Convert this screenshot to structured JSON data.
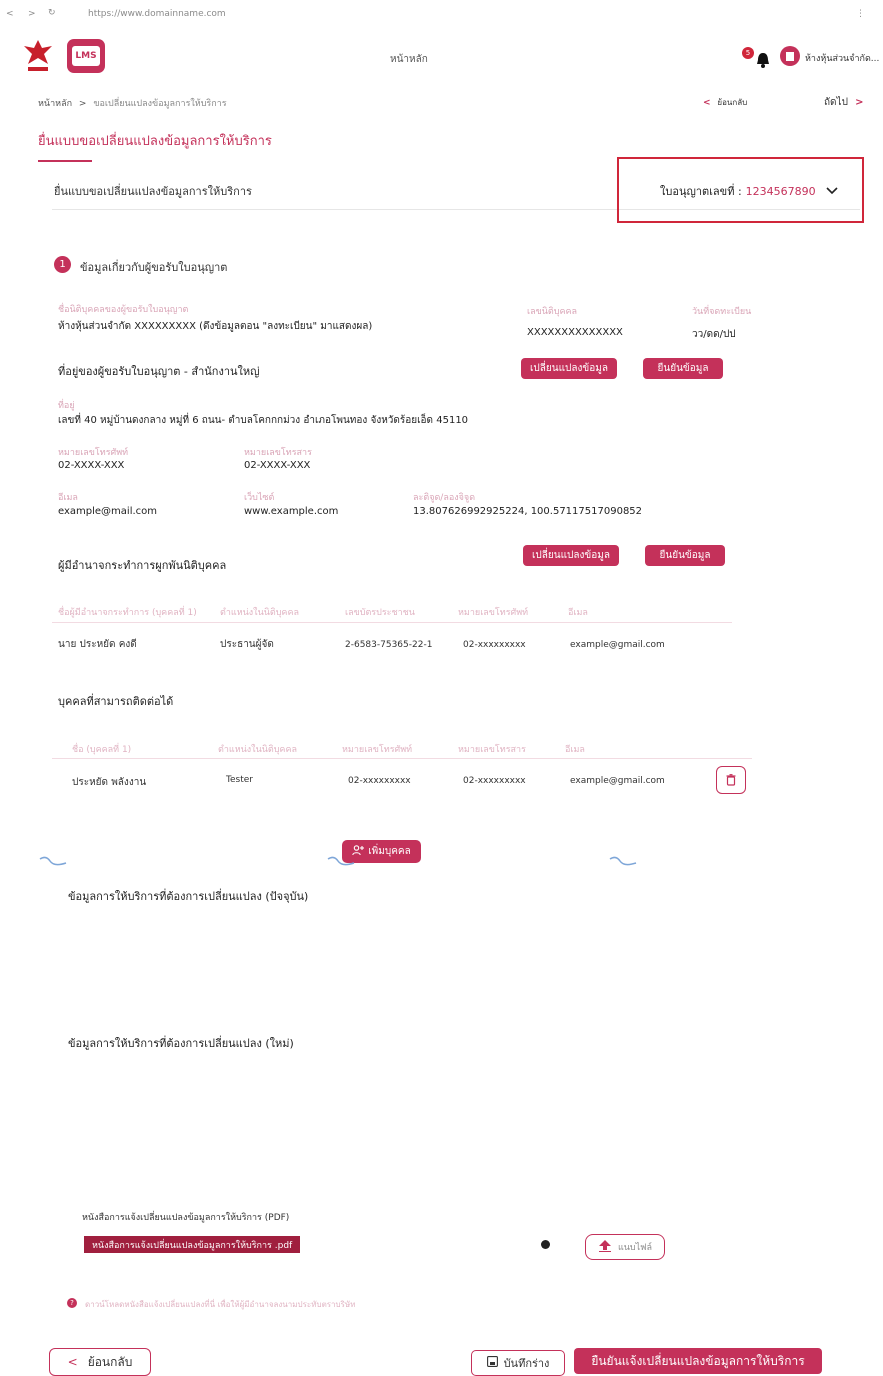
{
  "browser": {
    "url": "https://www.domainname.com"
  },
  "header": {
    "home_label": "หน้าหลัก",
    "notification_count": "5",
    "user_name": "ห้างหุ้นส่วนจำกัด...",
    "logo_text": "LMS"
  },
  "breadcrumb": {
    "home": "หน้าหลัก",
    "separator": ">",
    "current": "ขอเปลี่ยนแปลงข้อมูลการให้บริการ"
  },
  "pager": {
    "prev": "ย้อนกลับ",
    "next": "ถัดไป"
  },
  "page": {
    "title": "ยื่นแบบขอเปลี่ยนแปลงข้อมูลการให้บริการ",
    "subtitle": "ยื่นแบบขอเปลี่ยนแปลงข้อมูลการให้บริการ",
    "license_label": "ใบอนุญาตเลขที่ :",
    "license_number": "1234567890"
  },
  "section1": {
    "number": "1",
    "title": "ข้อมูลเกี่ยวกับผู้ขอรับใบอนุญาต",
    "applicant_label": "ชื่อนิติบุคคลของผู้ขอรับใบอนุญาต",
    "applicant_value": "ห้างหุ้นส่วนจำกัด XXXXXXXXX (ดึงข้อมูลตอน \"ลงทะเบียน\" มาแสดงผล)",
    "juristic_label": "เลขนิติบุคคล",
    "juristic_value": "XXXXXXXXXXXXXX",
    "regdate_label": "วันที่จดทะเบียน",
    "regdate_value": "วว/ดด/ปป"
  },
  "address": {
    "title": "ที่อยู่ของผู้ขอรับใบอนุญาต - สำนักงานใหญ่",
    "change_btn": "เปลี่ยนแปลงข้อมูล",
    "confirm_btn": "ยืนยันข้อมูล",
    "addr_label": "ที่อยู่",
    "addr_value": "เลขที่ 40 หมู่บ้านดงกลาง หมู่ที่ 6 ถนน- ตำบลโคกกกม่วง อำเภอโพนทอง จังหวัดร้อยเอ็ด 45110",
    "phone_label": "หมายเลขโทรศัพท์",
    "phone_value": "02-XXXX-XXX",
    "fax_label": "หมายเลขโทรสาร",
    "fax_value": "02-XXXX-XXX",
    "email_label": "อีเมล",
    "email_value": "example@mail.com",
    "web_label": "เว็บไซต์",
    "web_value": "www.example.com",
    "geo_label": "ละติจูด/ลองจิจูด",
    "geo_value": "13.807626992925224, 100.57117517090852"
  },
  "authorized": {
    "title": "ผู้มีอำนาจกระทำการผูกพันนิติบุคคล",
    "change_btn": "เปลี่ยนแปลงข้อมูล",
    "confirm_btn": "ยืนยันข้อมูล",
    "headers": [
      "ชื่อผู้มีอำนาจกระทำการ (บุคคลที่ 1)",
      "ตำแหน่งในนิติบุคคล",
      "เลขบัตรประชาชน",
      "หมายเลขโทรศัพท์",
      "อีเมล"
    ],
    "row": [
      "นาย ประหยัด คงดี",
      "ประธานผู้จัด",
      "2-6583-75365-22-1",
      "02-xxxxxxxxx",
      "example@gmail.com"
    ]
  },
  "contacts": {
    "title": "บุคคลที่สามารถติดต่อได้",
    "headers": [
      "ชื่อ (บุคคลที่ 1)",
      "ตำแหน่งในนิติบุคคล",
      "หมายเลขโทรศัพท์",
      "หมายเลขโทรสาร",
      "อีเมล"
    ],
    "row": [
      "ประหยัด พลังงาน",
      "Tester",
      "02-xxxxxxxxx",
      "02-xxxxxxxxx",
      "example@gmail.com"
    ],
    "add_btn": "เพิ่มบุคคล"
  },
  "service_current": {
    "title": "ข้อมูลการให้บริการที่ต้องการเปลี่ยนแปลง (ปัจจุบัน)"
  },
  "service_new": {
    "title": "ข้อมูลการให้บริการที่ต้องการเปลี่ยนแปลง (ใหม่)"
  },
  "upload": {
    "label": "หนังสือการแจ้งเปลี่ยนแปลงข้อมูลการให้บริการ (PDF)",
    "file_name": "หนังสือการแจ้งเปลี่ยนแปลงข้อมูลการให้บริการ .pdf",
    "attach_btn": "แนบไฟล์",
    "note": "ดาวน์โหลดหนังสือแจ้งเปลี่ยนแปลงที่นี่ เพื่อให้ผู้มีอำนาจลงนามประทับตราบริษัท"
  },
  "footer": {
    "back_btn": "ย้อนกลับ",
    "draft_btn": "บันทึกร่าง",
    "submit_btn": "ยืนยันแจ้งเปลี่ยนแปลงข้อมูลการให้บริการ"
  },
  "colors": {
    "accent": "#c4315a",
    "highlight_box": "#d0263a",
    "link": "#c4315a"
  }
}
